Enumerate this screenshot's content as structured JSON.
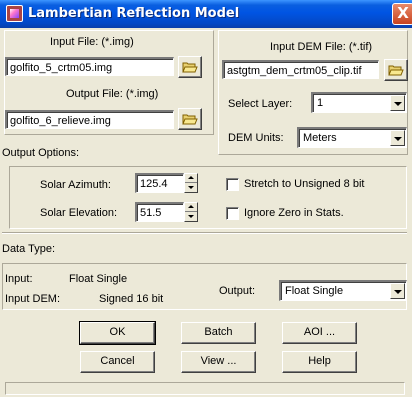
{
  "window": {
    "title": "Lambertian Reflection Model",
    "close_glyph": "X"
  },
  "input_file": {
    "label": "Input File: (*.img)",
    "value": "golfito_5_crtm05.img"
  },
  "output_file": {
    "label": "Output File: (*.img)",
    "value": "golfito_6_relieve.img"
  },
  "dem_file": {
    "label": "Input DEM File: (*.tif)",
    "value": "astgtm_dem_crtm05_clip.tif"
  },
  "select_layer": {
    "label": "Select Layer:",
    "value": "1"
  },
  "dem_units": {
    "label": "DEM Units:",
    "value": "Meters"
  },
  "output_options": {
    "label": "Output Options:",
    "solar_azimuth": {
      "label": "Solar Azimuth:",
      "value": "125.4"
    },
    "solar_elevation": {
      "label": "Solar Elevation:",
      "value": "51.5"
    },
    "stretch_label": "Stretch to Unsigned 8 bit",
    "ignore_zero_label": "Ignore Zero in Stats."
  },
  "data_type": {
    "label": "Data Type:",
    "input_label": "Input:",
    "input_value": "Float Single",
    "input_dem_label": "Input DEM:",
    "input_dem_value": "Signed 16 bit",
    "output_label": "Output:",
    "output_value": "Float Single"
  },
  "buttons": {
    "ok": "OK",
    "batch": "Batch",
    "aoi": "AOI ...",
    "cancel": "Cancel",
    "view": "View ...",
    "help": "Help"
  },
  "icons": {
    "folder": "open-folder-icon",
    "dropdown": "chevron-down-icon"
  }
}
